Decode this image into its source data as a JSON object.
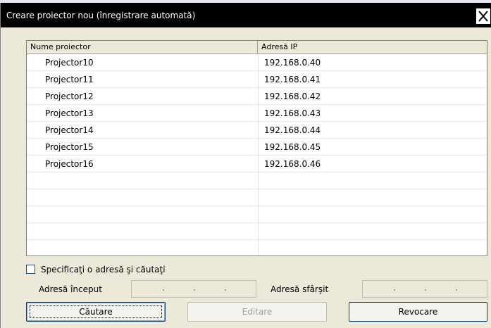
{
  "window": {
    "title": "Creare proiector nou (înregistrare automată)"
  },
  "list": {
    "columns": [
      "Nume proiector",
      "Adresă IP"
    ],
    "rows": [
      {
        "name": "Projector10",
        "ip": "192.168.0.40"
      },
      {
        "name": "Projector11",
        "ip": "192.168.0.41"
      },
      {
        "name": "Projector12",
        "ip": "192.168.0.42"
      },
      {
        "name": "Projector13",
        "ip": "192.168.0.43"
      },
      {
        "name": "Projector14",
        "ip": "192.168.0.44"
      },
      {
        "name": "Projector15",
        "ip": "192.168.0.45"
      },
      {
        "name": "Projector16",
        "ip": "192.168.0.46"
      }
    ]
  },
  "search_option": {
    "label": "Specificaţi o adresă şi căutaţi",
    "checked": false
  },
  "address": {
    "start_label": "Adresă început",
    "end_label": "Adresă sfârşit"
  },
  "buttons": {
    "search": "Căutare",
    "edit": "Editare",
    "cancel": "Revocare"
  },
  "icons": {
    "close": "close-icon"
  }
}
